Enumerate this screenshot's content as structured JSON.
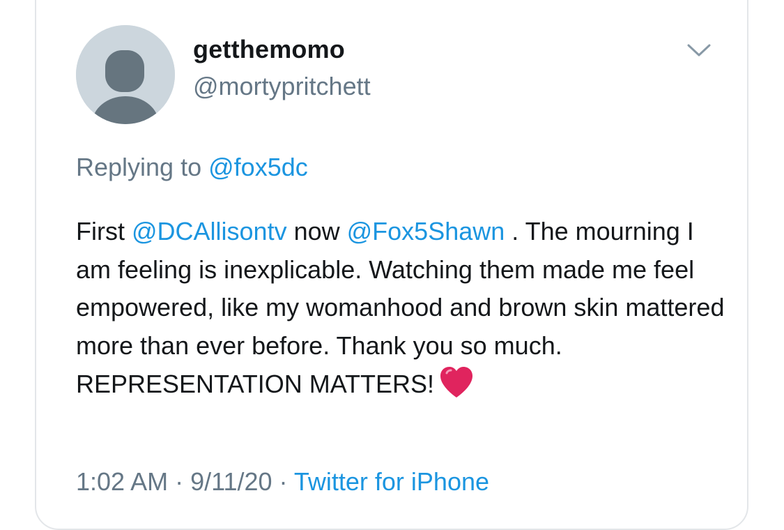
{
  "user": {
    "display_name": "getthemomo",
    "handle": "@mortypritchett",
    "avatar_icon": "default-avatar-icon"
  },
  "menu": {
    "icon": "chevron-down-icon"
  },
  "reply": {
    "prefix": "Replying to",
    "to": "@fox5dc"
  },
  "tweet": {
    "part1": "First ",
    "mention1": "@DCAllisontv",
    "part2": " now ",
    "mention2": "@Fox5Shawn",
    "part3": " . The mourning I am feeling is inexplicable. Watching them made me feel empowered, like my womanhood and brown skin mattered more than ever before. Thank you so much. REPRESENTATION MATTERS!",
    "emoji": "red-heart-icon"
  },
  "meta": {
    "time": "1:02 AM",
    "separator1": " · ",
    "date": "9/11/20",
    "separator2": " · ",
    "source": "Twitter for iPhone"
  },
  "colors": {
    "link": "#1b95e0",
    "secondary_text": "#657786",
    "primary_text": "#14171a",
    "avatar_bg": "#ccd6dd",
    "avatar_fg": "#66757f",
    "heart": "#e0245e"
  }
}
